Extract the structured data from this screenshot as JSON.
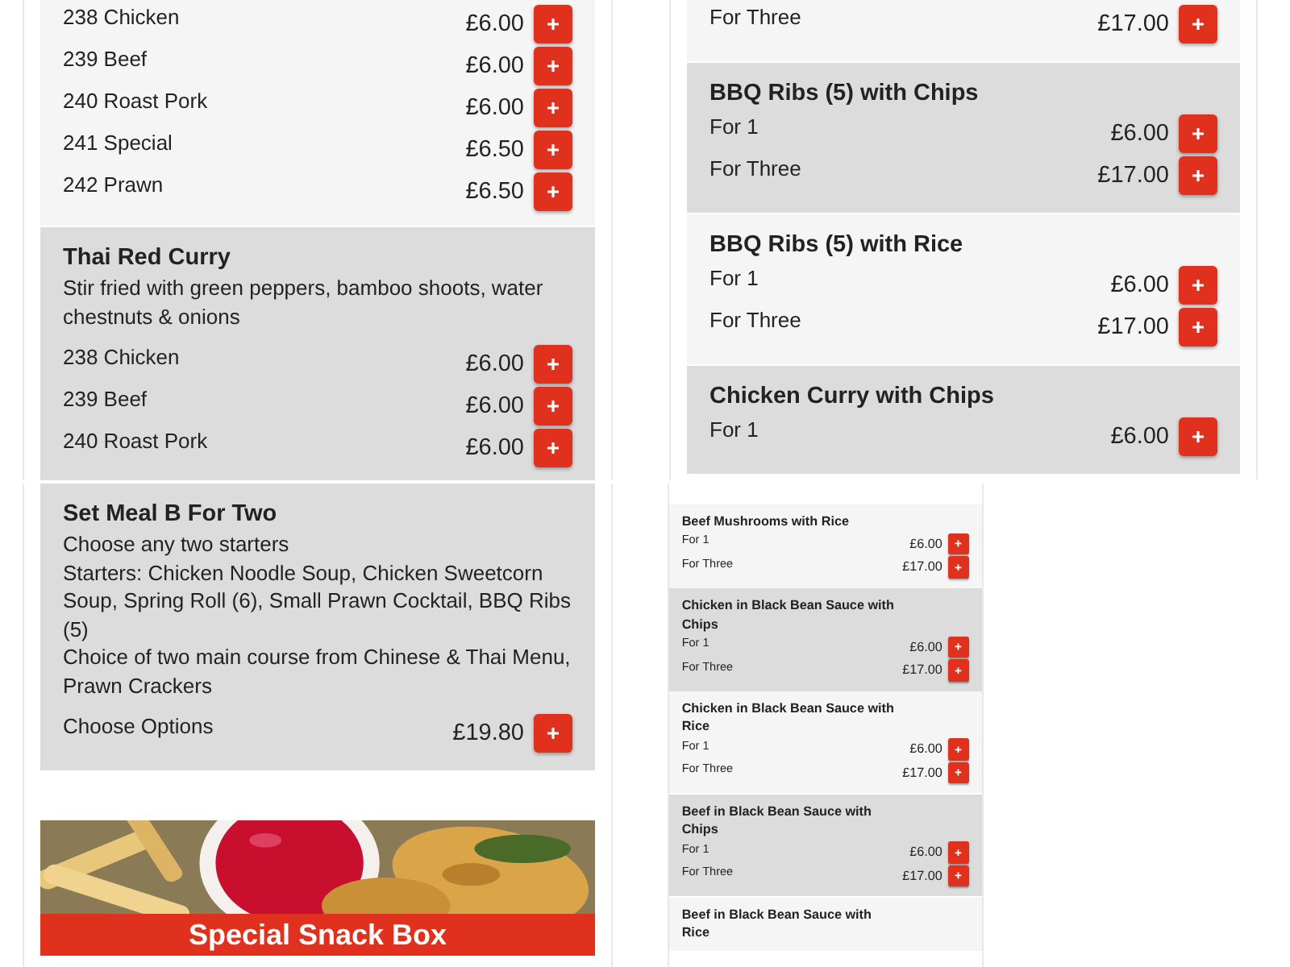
{
  "tiles": [
    {
      "sections": [
        {
          "color": "#f5f5f5",
          "options": [
            {
              "label": "238 Chicken",
              "price": "£6.00"
            },
            {
              "label": "239 Beef",
              "price": "£6.00"
            },
            {
              "label": "240 Roast Pork",
              "price": "£6.00"
            },
            {
              "label": "241 Special",
              "price": "£6.50"
            },
            {
              "label": "242 Prawn",
              "price": "£6.50"
            }
          ]
        },
        {
          "color": "#dcdcdc",
          "title": "Thai Red Curry",
          "description": [
            "Stir fried with green peppers, bamboo shoots, water chestnuts & onions"
          ],
          "options": [
            {
              "label": "238 Chicken",
              "price": "£6.00"
            },
            {
              "label": "239 Beef",
              "price": "£6.00"
            },
            {
              "label": "240 Roast Pork",
              "price": "£6.00"
            }
          ]
        }
      ]
    },
    {
      "sections": [
        {
          "color": "#f5f5f5",
          "options": [
            {
              "label": "For Three",
              "price": "£17.00"
            }
          ]
        },
        {
          "color": "#dcdcdc",
          "title": "BBQ Ribs (5) with Chips",
          "options": [
            {
              "label": "For 1",
              "price": "£6.00"
            },
            {
              "label": "For Three",
              "price": "£17.00"
            }
          ]
        },
        {
          "color": "#f5f5f5",
          "title": "BBQ Ribs (5) with Rice",
          "options": [
            {
              "label": "For 1",
              "price": "£6.00"
            },
            {
              "label": "For Three",
              "price": "£17.00"
            }
          ]
        },
        {
          "color": "#dcdcdc",
          "title": "Chicken Curry with Chips",
          "options": [
            {
              "label": "For 1",
              "price": "£6.00"
            }
          ]
        }
      ]
    },
    {
      "sections": [
        {
          "color": "#dcdcdc",
          "title": "Set Meal B For Two",
          "description": [
            "Choose any two starters",
            "Starters: Chicken Noodle Soup, Chicken Sweetcorn Soup, Spring Roll (6), Small Prawn Cocktail, BBQ Ribs (5)",
            "Choice of two main course from Chinese & Thai Menu, Prawn Crackers"
          ],
          "options": [
            {
              "label": "Choose Options",
              "price": "£19.80"
            }
          ]
        }
      ],
      "promo": {
        "kind": "picture",
        "banner": "Special Snack Box"
      }
    },
    {
      "sections": [
        {
          "color": "#f5f5f5",
          "title": "Beef Mushrooms with Rice",
          "options": [
            {
              "label": "For 1",
              "price": "£6.00"
            },
            {
              "label": "For Three",
              "price": "£17.00"
            }
          ]
        },
        {
          "color": "#dcdcdc",
          "title": "Chicken in Black Bean Sauce with Chips",
          "options": [
            {
              "label": "For 1",
              "price": "£6.00"
            },
            {
              "label": "For Three",
              "price": "£17.00"
            }
          ]
        },
        {
          "color": "#f5f5f5",
          "title": "Chicken in Black Bean Sauce with Rice",
          "options": [
            {
              "label": "For 1",
              "price": "£6.00"
            },
            {
              "label": "For Three",
              "price": "£17.00"
            }
          ]
        },
        {
          "color": "#dcdcdc",
          "title": "Beef in Black Bean Sauce with Chips",
          "options": [
            {
              "label": "For 1",
              "price": "£6.00"
            },
            {
              "label": "For Three",
              "price": "£17.00"
            }
          ]
        },
        {
          "color": "#f5f5f5",
          "title": "Beef in Black Bean Sauce with Rice"
        }
      ]
    }
  ]
}
